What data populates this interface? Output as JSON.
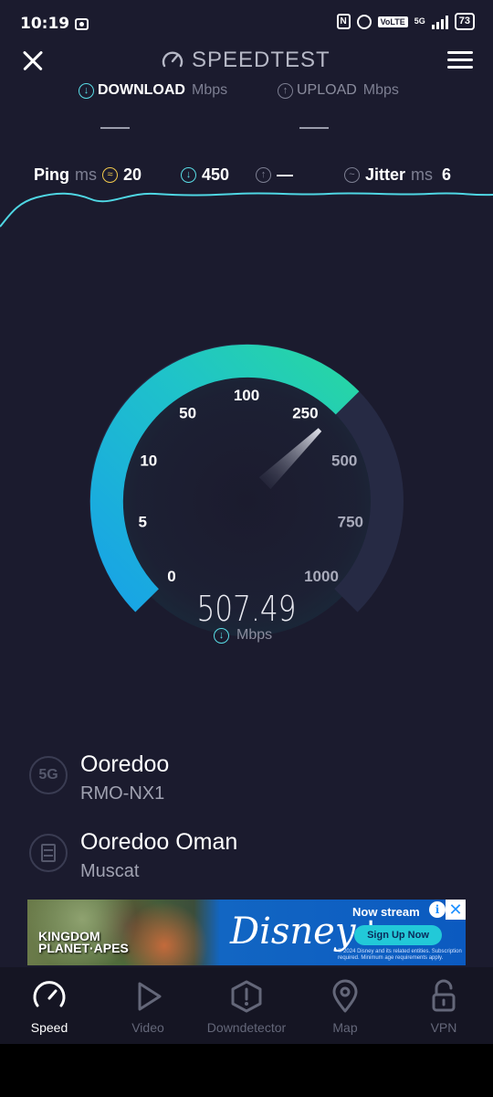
{
  "status": {
    "time": "10:19",
    "network": "5G",
    "volte": "VoLTE",
    "battery": "73"
  },
  "header": {
    "title": "SPEEDTEST"
  },
  "tabs": {
    "download_label": "DOWNLOAD",
    "download_unit": "Mbps",
    "upload_label": "UPLOAD",
    "upload_unit": "Mbps",
    "download_value": "—",
    "upload_value": "—"
  },
  "metrics": {
    "ping_label": "Ping",
    "ping_unit": "ms",
    "idle_ping": "20",
    "download_ping": "450",
    "upload_ping": "—",
    "jitter_label": "Jitter",
    "jitter_unit": "ms",
    "jitter": "6"
  },
  "gauge": {
    "scale_labels": [
      "0",
      "5",
      "10",
      "50",
      "100",
      "250",
      "500",
      "750",
      "1000"
    ],
    "current_speed": "507.49",
    "unit": "Mbps",
    "progress_fraction": 0.67,
    "colors": {
      "start": "#1aa7e8",
      "end": "#24d3a5",
      "track": "#262a44"
    }
  },
  "connection": {
    "network_badge": "5G",
    "provider": "Ooredoo",
    "device": "RMO-NX1",
    "server_name": "Ooredoo Oman",
    "server_location": "Muscat"
  },
  "ad": {
    "left_title": "KINGDOM\nPLANET· APES",
    "brand": "Disney+",
    "headline": "Now stream",
    "cta": "Sign Up Now",
    "fine_print": "© 2024 Disney and its related entities. Subscription required. Minimum age requirements apply."
  },
  "nav": {
    "items": [
      {
        "label": "Speed",
        "icon": "speedometer-icon"
      },
      {
        "label": "Video",
        "icon": "play-icon"
      },
      {
        "label": "Downdetector",
        "icon": "alert-icon"
      },
      {
        "label": "Map",
        "icon": "map-pin-icon"
      },
      {
        "label": "VPN",
        "icon": "lock-icon"
      }
    ]
  }
}
